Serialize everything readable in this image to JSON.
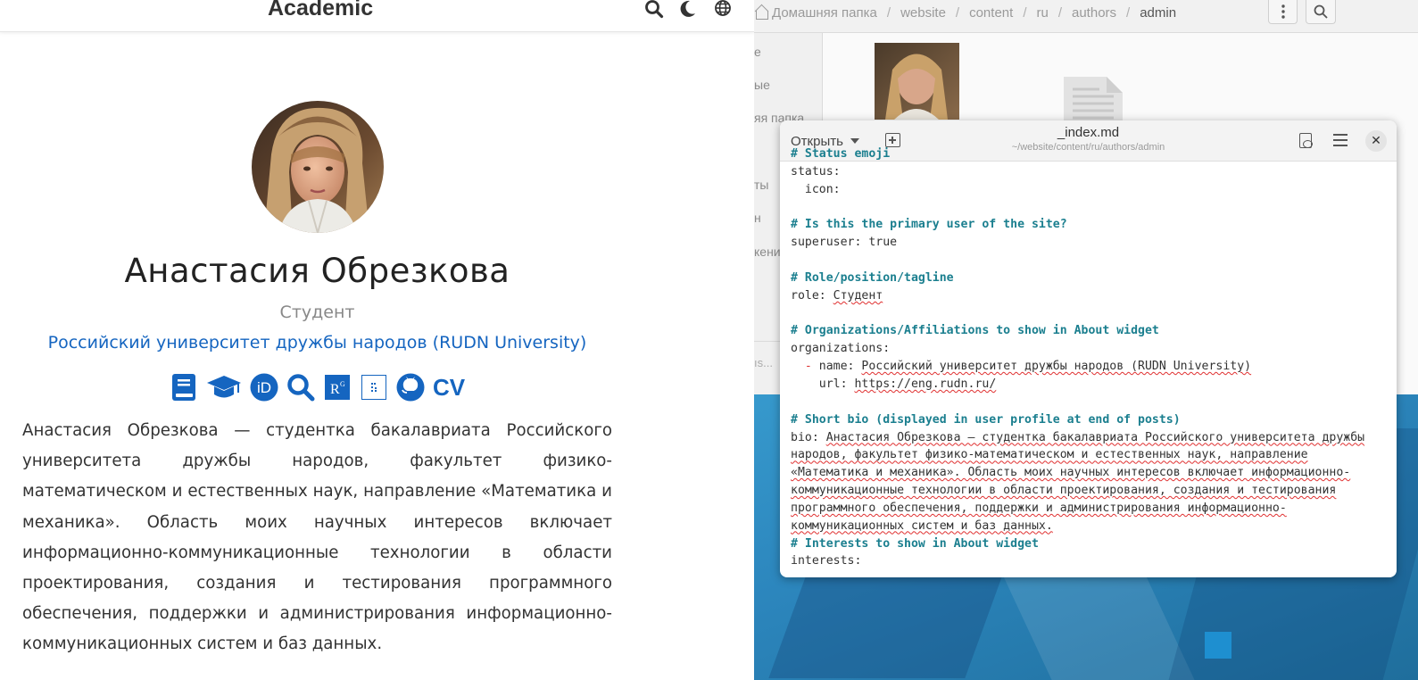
{
  "site": {
    "brand": "Academic",
    "nav_icons": [
      "search-icon",
      "moon-icon",
      "globe-icon"
    ],
    "name": "Анастасия Обрезкова",
    "role": "Студент",
    "organization": "Российский университет дружбы народов (RUDN University)",
    "social_icons": [
      "book-icon",
      "graduation-cap-icon",
      "orcid-icon",
      "search-icon",
      "researchgate-icon",
      "figshare-icon",
      "github-icon",
      "cv-icon"
    ],
    "cv_label": "CV",
    "rg_label": "R",
    "bio": "Анастасия Обрезкова — студентка бакалавриата Российского университета дружбы народов, факультет физико-математическом и естественных наук, направление «Математика и механика». Область моих научных интересов включает информационно-коммуникационные технологии в области проектирования, создания и тестирования программного обеспечения, поддержки и администрирования информационно-коммуникационных систем и баз данных.",
    "colors": {
      "accent": "#1565c0",
      "text": "#333333"
    }
  },
  "files": {
    "breadcrumbs": [
      "Домашняя папка",
      "website",
      "content",
      "ru",
      "authors",
      "admin"
    ],
    "sidebar_items": [
      "е",
      "ые",
      "яя папка",
      "ты",
      "н",
      "кени"
    ],
    "sidebar_bottom": "ıs..."
  },
  "editor": {
    "open_label": "Открыть",
    "title": "_index.md",
    "subtitle": "~/website/content/ru/authors/admin",
    "close_symbol": "✕",
    "lines": {
      "l0": "# Status emoji",
      "l1": "status:",
      "l2": "  icon:",
      "l3": "# Is this the primary user of the site?",
      "l4a": "superuser: ",
      "l4b": "true",
      "l5": "# Role/position/tagline",
      "l6a": "role: ",
      "l6b": "Студент",
      "l7": "# Organizations/Affiliations to show in About widget",
      "l8a": "organizations:",
      "l9dash": "  - ",
      "l9a": "name: ",
      "l9b": "Российский университет дружбы народов (RUDN University)",
      "l10a": "    url: ",
      "l10b": "https://eng.rudn.ru/",
      "l11": "# Short bio (displayed in user profile at end of posts)",
      "l12a": "bio: ",
      "l12b": "Анастасия Обрезкова — студентка бакалавриата Российского университета дружбы",
      "l13": "народов, факультет физико-математическом и естественных наук, направление",
      "l14": "«Математика и механика». Область моих научных интересов включает информационно-",
      "l15": "коммуникационные технологии в области проектирования, создания и тестирования",
      "l16": "программного обеспечения, поддержки и администрирования информационно-",
      "l17": "коммуникационных систем и баз данных.",
      "l18": "# Interests to show in About widget",
      "l19": "interests:"
    }
  }
}
